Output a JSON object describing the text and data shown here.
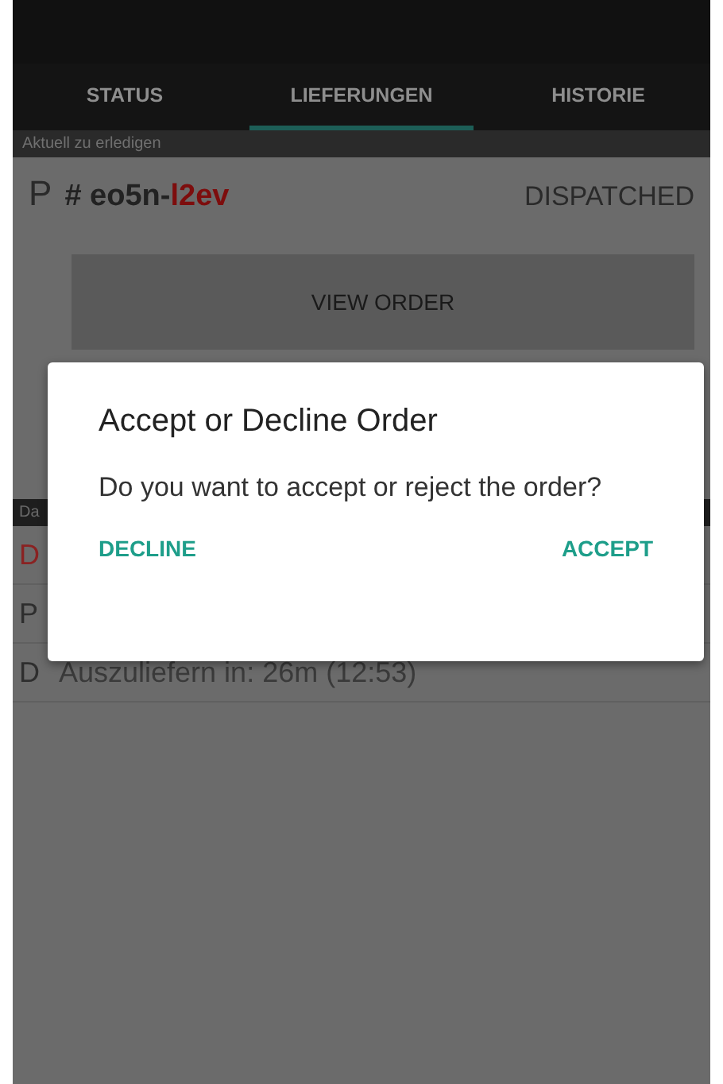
{
  "tabs": [
    {
      "label": "STATUS",
      "selected": false
    },
    {
      "label": "LIEFERUNGEN",
      "selected": true
    },
    {
      "label": "HISTORIE",
      "selected": false
    }
  ],
  "subheader": "Aktuell zu erledigen",
  "order": {
    "type_letter": "P",
    "id_prefix": "# eo5n-",
    "id_highlight": "l2ev",
    "status": "DISPATCHED",
    "button": "VIEW ORDER"
  },
  "section_header": "Da",
  "rows": [
    {
      "letter": "D",
      "color": "#8a2222"
    },
    {
      "letter": "P",
      "color": "#2e2e2e"
    },
    {
      "letter": "D",
      "color": "#2e2e2e",
      "text": "Auszuliefern in: 26m (12:53)"
    }
  ],
  "dialog": {
    "title": "Accept or Decline Order",
    "message": "Do you want to accept or reject the order?",
    "buttons": [
      "DECLINE",
      "ACCEPT"
    ]
  }
}
